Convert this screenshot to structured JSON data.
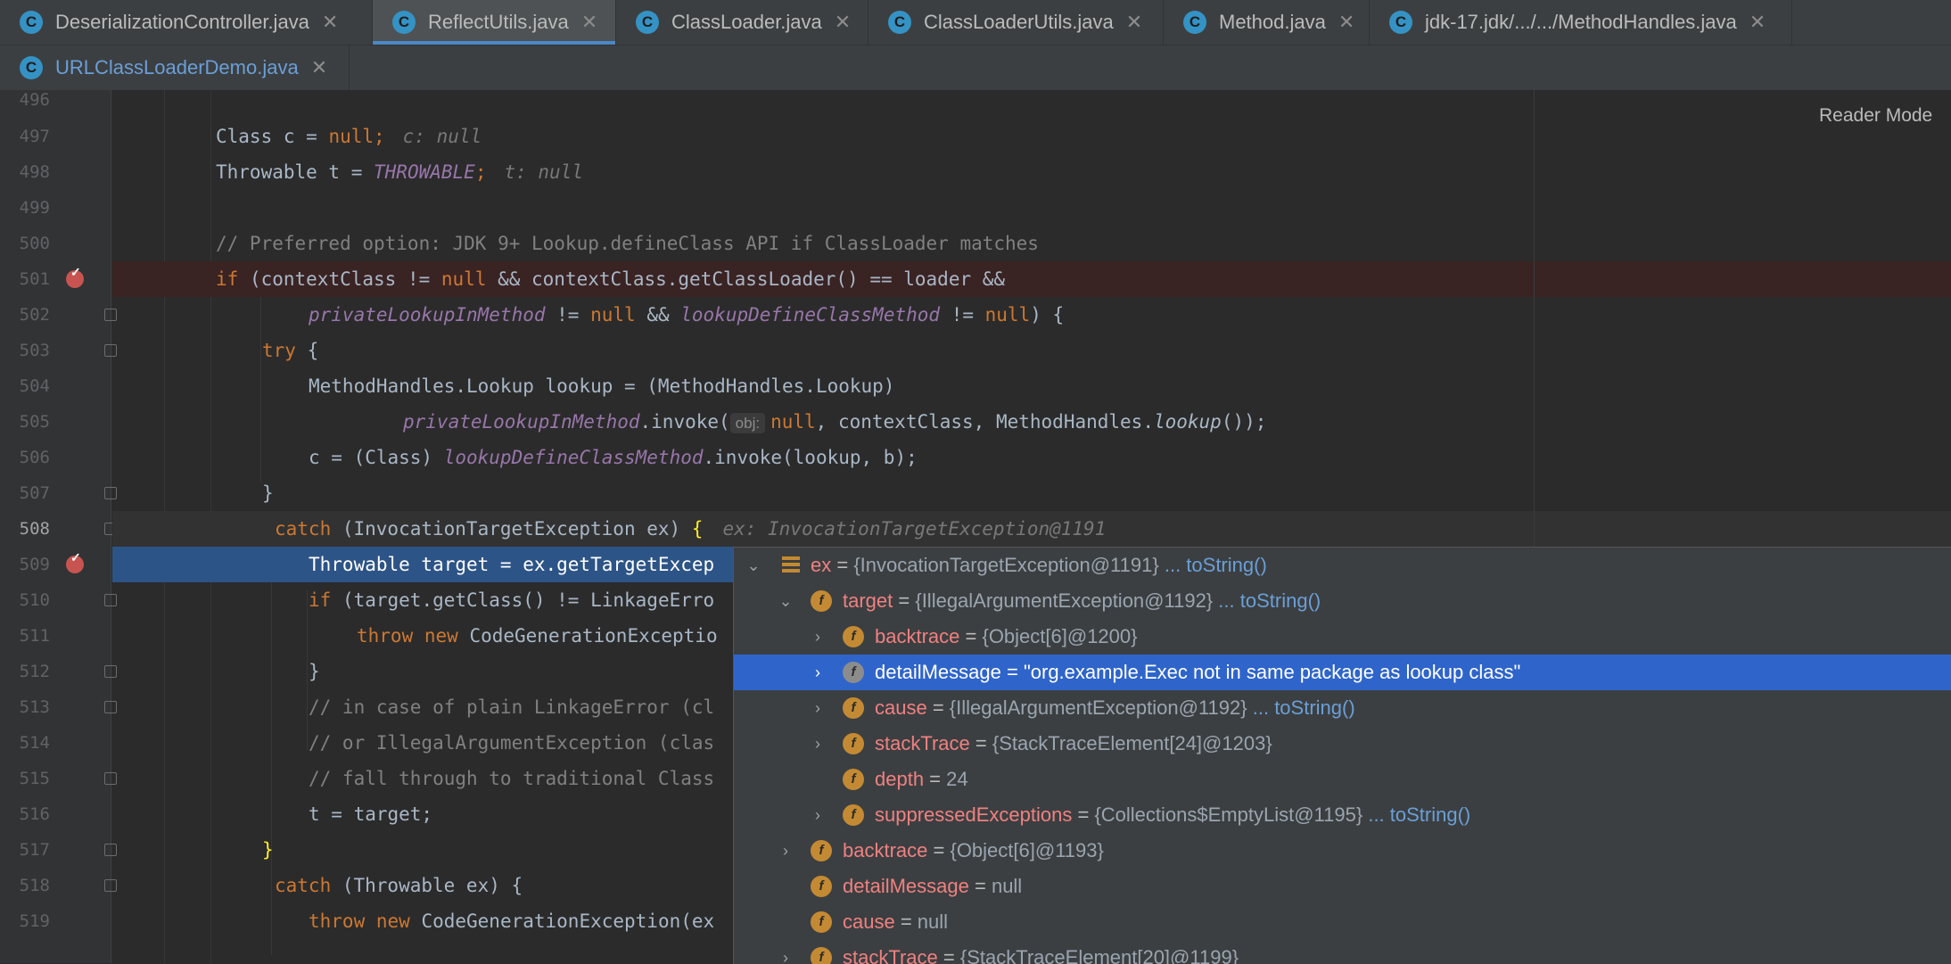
{
  "tabs_row1": [
    {
      "label": "DeserializationController.java",
      "active": false
    },
    {
      "label": "ReflectUtils.java",
      "active": true
    },
    {
      "label": "ClassLoader.java",
      "active": false
    },
    {
      "label": "ClassLoaderUtils.java",
      "active": false
    },
    {
      "label": "Method.java",
      "active": false
    },
    {
      "label": "jdk-17.jdk/.../.../MethodHandles.java",
      "active": false
    }
  ],
  "tabs_row2": [
    {
      "label": "URLClassLoaderDemo.java",
      "active": false
    }
  ],
  "tab_close_glyph": "✕",
  "tab_icon_letter": "C",
  "editor": {
    "reader_mode": "Reader Mode",
    "line_numbers": [
      "496",
      "497",
      "498",
      "499",
      "500",
      "501",
      "502",
      "503",
      "504",
      "505",
      "506",
      "507",
      "508",
      "509",
      "510",
      "511",
      "512",
      "513",
      "514",
      "515",
      "516",
      "517",
      "518",
      "519"
    ],
    "lines": {
      "l497": "Class c = ",
      "l497b": "null",
      "l497c": ";",
      "l497d": "c: null",
      "l498": "Throwable t = ",
      "l498b": "THROWABLE",
      "l498c": ";",
      "l498d": "t: null",
      "l500": "// Preferred option: JDK 9+ Lookup.defineClass API if ClassLoader matches",
      "l501a": "if",
      "l501b": " (contextClass != ",
      "l501c": "null",
      "l501d": " && contextClass.getClassLoader() == loader &&",
      "l502a": "privateLookupInMethod",
      "l502b": " != ",
      "l502c": "null",
      "l502d": " && ",
      "l502e": "lookupDefineClassMethod",
      "l502f": " != ",
      "l502g": "null",
      "l502h": ") {",
      "l503a": "try",
      "l503b": " {",
      "l504": "MethodHandles.Lookup lookup = (MethodHandles.Lookup)",
      "l505a": "privateLookupInMethod",
      "l505b": ".invoke(",
      "l505hint": "obj:",
      "l505c": "null",
      "l505d": ", contextClass, MethodHandles.",
      "l505e": "lookup",
      "l505f": "());",
      "l506a": "c = (Class) ",
      "l506b": "lookupDefineClassMethod",
      "l506c": ".invoke(lookup, b);",
      "l507": "}",
      "l508a": "catch",
      "l508b": " (InvocationTargetException ex) ",
      "l508c": "{",
      "l508d": "ex: InvocationTargetException@1191",
      "l509": "Throwable target = ex.getTargetExcep",
      "l510a": "if",
      "l510b": " (target.getClass() != LinkageErro",
      "l511a": "throw new",
      "l511b": " CodeGenerationExceptio",
      "l512": "}",
      "l513": "// in case of plain LinkageError (cl",
      "l514": "// or IllegalArgumentException (clas",
      "l515": "// fall through to traditional Class",
      "l516": "t = target;",
      "l517": "}",
      "l518a": "catch",
      "l518b": " (Throwable ex) {",
      "l519a": "throw new",
      "l519b": " CodeGenerationException(ex"
    }
  },
  "debug_tree": [
    {
      "name": "ex",
      "value": "{InvocationTargetException@1191}",
      "link": "... toString()",
      "expander": "⌄",
      "icon": "stack"
    },
    {
      "name": "target",
      "value": "{IllegalArgumentException@1192}",
      "link": "... toString()",
      "expander": "⌄",
      "icon": "f"
    },
    {
      "name": "backtrace",
      "value": "{Object[6]@1200}",
      "link": "",
      "expander": "›",
      "icon": "f"
    },
    {
      "name": "detailMessage",
      "value": "\"org.example.Exec not in same package as lookup class\"",
      "link": "",
      "expander": "›",
      "icon": "f"
    },
    {
      "name": "cause",
      "value": "{IllegalArgumentException@1192}",
      "link": "... toString()",
      "expander": "›",
      "icon": "f"
    },
    {
      "name": "stackTrace",
      "value": "{StackTraceElement[24]@1203}",
      "link": "",
      "expander": "›",
      "icon": "f"
    },
    {
      "name": "depth",
      "value": "24",
      "link": "",
      "expander": "",
      "icon": "f"
    },
    {
      "name": "suppressedExceptions",
      "value": "{Collections$EmptyList@1195}",
      "link": "... toString()",
      "expander": "›",
      "icon": "f"
    },
    {
      "name": "backtrace",
      "value": "{Object[6]@1193}",
      "link": "",
      "expander": "›",
      "icon": "f"
    },
    {
      "name": "detailMessage",
      "value": "null",
      "link": "",
      "expander": "",
      "icon": "f"
    },
    {
      "name": "cause",
      "value": "null",
      "link": "",
      "expander": "",
      "icon": "f"
    },
    {
      "name": "stackTrace",
      "value": "{StackTraceElement[20]@1199}",
      "link": "",
      "expander": "›",
      "icon": "f"
    }
  ],
  "equals": " = ",
  "field_icon_letter": "f"
}
